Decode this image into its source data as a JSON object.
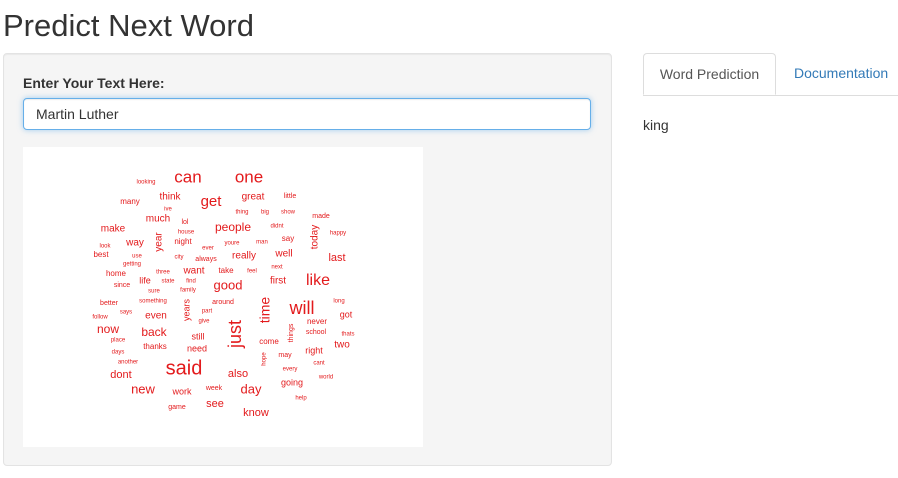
{
  "page_title": "Predict Next Word",
  "input": {
    "label": "Enter Your Text Here:",
    "value": "Martin Luther"
  },
  "tabs": [
    {
      "label": "Word Prediction",
      "active": true
    },
    {
      "label": "Documentation",
      "active": false
    }
  ],
  "prediction": "king",
  "wordcloud": {
    "color": "#e31a1c",
    "words": [
      "can",
      "one",
      "think",
      "many",
      "looking",
      "ive",
      "get",
      "great",
      "little",
      "much",
      "lol",
      "thing",
      "big",
      "show",
      "made",
      "make",
      "house",
      "people",
      "didnt",
      "way",
      "night",
      "year",
      "youre",
      "man",
      "say",
      "today",
      "happy",
      "look",
      "ever",
      "best",
      "use",
      "city",
      "always",
      "really",
      "well",
      "last",
      "getting",
      "next",
      "home",
      "three",
      "want",
      "take",
      "feel",
      "life",
      "state",
      "find",
      "like",
      "since",
      "family",
      "good",
      "first",
      "better",
      "something",
      "around",
      "long",
      "says",
      "part",
      "will",
      "follow",
      "sure",
      "give",
      "even",
      "got",
      "now",
      "years",
      "time",
      "never",
      "just",
      "place",
      "school",
      "thats",
      "back",
      "still",
      "things",
      "days",
      "thanks",
      "need",
      "come",
      "right",
      "two",
      "another",
      "may",
      "hope",
      "cant",
      "dont",
      "said",
      "also",
      "every",
      "world",
      "new",
      "week",
      "day",
      "going",
      "work",
      "help",
      "game",
      "see",
      "know"
    ]
  }
}
